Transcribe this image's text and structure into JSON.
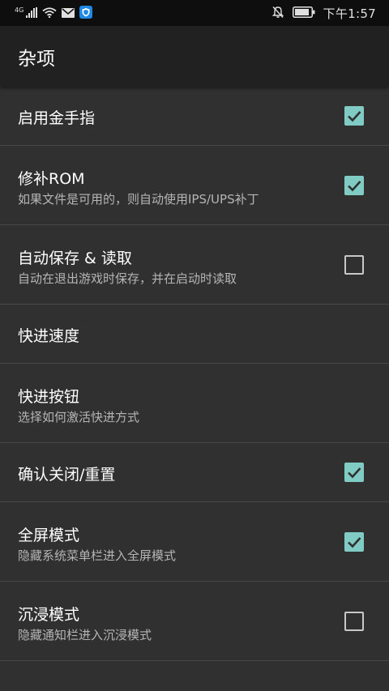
{
  "status_bar": {
    "network": "4G",
    "time": "下午1:57"
  },
  "app_bar": {
    "title": "杂项"
  },
  "colors": {
    "accent": "#80cbc4",
    "background": "#303030",
    "app_bar": "#212121",
    "status_bar": "#0e0e0e"
  },
  "settings": [
    {
      "title": "启用金手指",
      "subtitle": "",
      "checked": true
    },
    {
      "title": "修补ROM",
      "subtitle": "如果文件是可用的，则自动使用IPS/UPS补丁",
      "checked": true
    },
    {
      "title": "自动保存 & 读取",
      "subtitle": "自动在退出游戏时保存，并在启动时读取",
      "checked": false
    },
    {
      "title": "快进速度",
      "subtitle": ""
    },
    {
      "title": "快进按钮",
      "subtitle": "选择如何激活快进方式"
    },
    {
      "title": "确认关闭/重置",
      "subtitle": "",
      "checked": true
    },
    {
      "title": "全屏模式",
      "subtitle": "隐藏系统菜单栏进入全屏模式",
      "checked": true
    },
    {
      "title": "沉浸模式",
      "subtitle": "隐藏通知栏进入沉浸模式",
      "checked": false
    }
  ]
}
